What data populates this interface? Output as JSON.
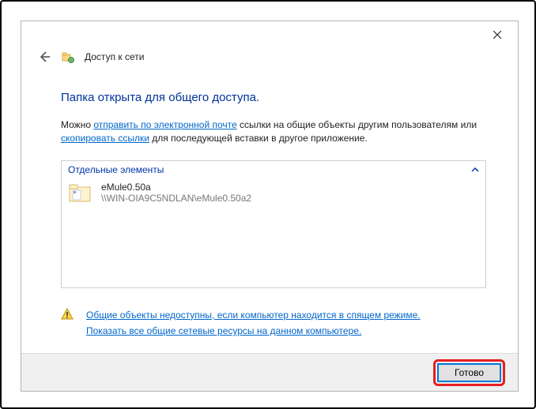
{
  "wizard": {
    "title": "Доступ к сети"
  },
  "main": {
    "heading": "Папка открыта для общего доступа.",
    "desc_prefix": "Можно ",
    "link_email": "отправить по электронной почте",
    "desc_mid": " ссылки на общие объекты другим пользователям или ",
    "link_copy": "скопировать ссылки",
    "desc_suffix": " для последующей вставки в другое приложение."
  },
  "group": {
    "label": "Отдельные элементы",
    "item": {
      "name": "eMule0.50a",
      "path": "\\\\WIN-OIA9C5NDLAN\\eMule0.50a2"
    }
  },
  "warn": {
    "link1": "Общие объекты недоступны, если компьютер находится в спящем режиме.",
    "link2": "Показать все общие сетевые ресурсы на данном компьютере."
  },
  "footer": {
    "done": "Готово"
  }
}
